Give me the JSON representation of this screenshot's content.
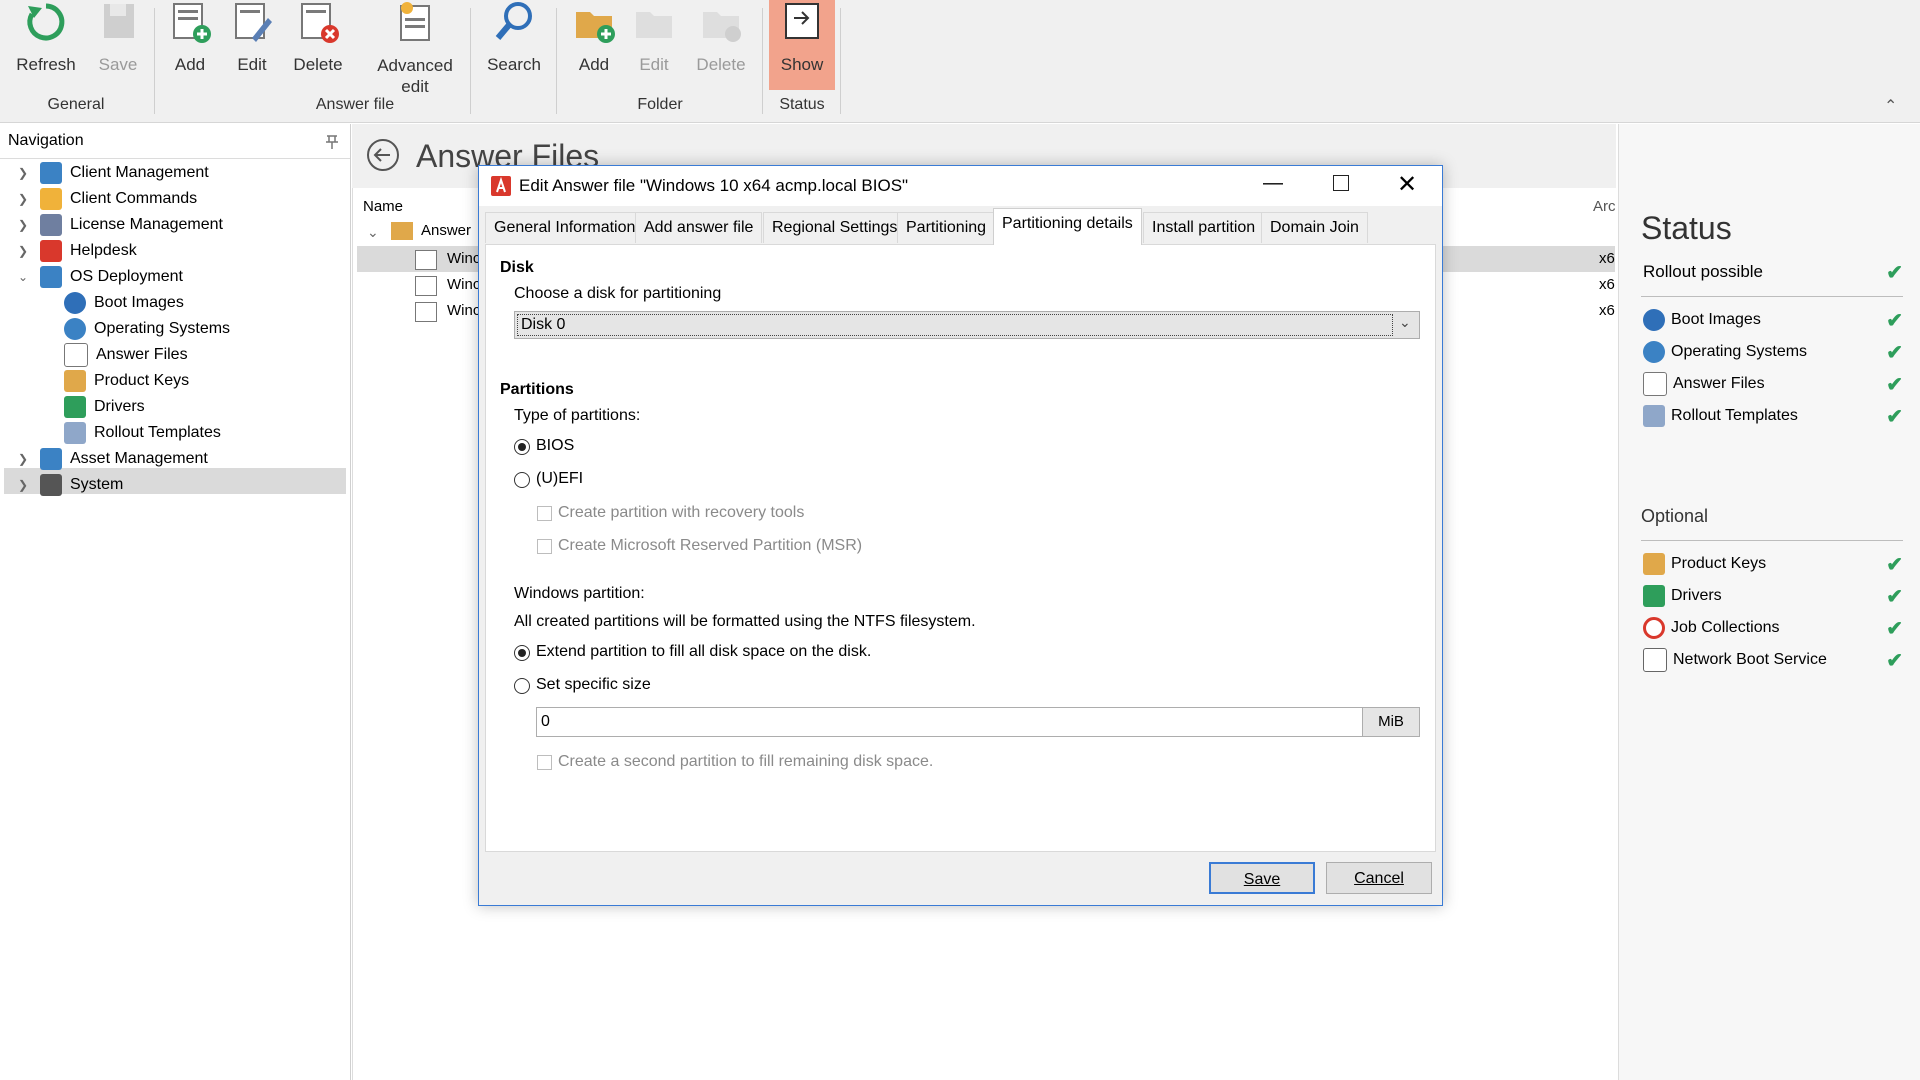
{
  "ribbon": {
    "buttons": [
      {
        "label": "Refresh",
        "enabled": true,
        "icon": "refresh-icon"
      },
      {
        "label": "Save",
        "enabled": false,
        "icon": "floppy-disk-icon"
      },
      {
        "label": "Add",
        "enabled": true,
        "icon": "add-document-icon"
      },
      {
        "label": "Edit",
        "enabled": true,
        "icon": "edit-document-icon"
      },
      {
        "label": "Delete",
        "enabled": true,
        "icon": "delete-document-icon"
      },
      {
        "label": "Advanced\nedit",
        "enabled": true,
        "icon": "advanced-edit-icon"
      },
      {
        "label": "Search",
        "enabled": true,
        "icon": "magnifier-icon"
      },
      {
        "label": "Add",
        "enabled": true,
        "icon": "add-folder-icon"
      },
      {
        "label": "Edit",
        "enabled": false,
        "icon": "edit-folder-icon"
      },
      {
        "label": "Delete",
        "enabled": false,
        "icon": "delete-folder-icon"
      },
      {
        "label": "Show",
        "enabled": true,
        "active": true,
        "icon": "show-status-icon"
      }
    ],
    "groups": [
      "General",
      "Answer file",
      "Folder",
      "Status"
    ],
    "collapse_glyph": "⌃"
  },
  "navigation": {
    "title": "Navigation",
    "items": [
      {
        "label": "Client Management",
        "expandable": true
      },
      {
        "label": "Client Commands",
        "expandable": true
      },
      {
        "label": "License Management",
        "expandable": true
      },
      {
        "label": "Helpdesk",
        "expandable": true
      },
      {
        "label": "OS Deployment",
        "expandable": true,
        "expanded": true
      },
      {
        "label": "Boot Images"
      },
      {
        "label": "Operating Systems"
      },
      {
        "label": "Answer Files",
        "selected": true
      },
      {
        "label": "Product Keys"
      },
      {
        "label": "Drivers"
      },
      {
        "label": "Rollout Templates"
      },
      {
        "label": "Asset Management",
        "expandable": true
      },
      {
        "label": "System",
        "expandable": true
      }
    ]
  },
  "content": {
    "title": "Answer Files",
    "columns": {
      "name": "Name",
      "arch": "Arc"
    },
    "folder": "Answer",
    "rows": [
      {
        "name": "Winc",
        "arch": "x6"
      },
      {
        "name": "Winc",
        "arch": "x6"
      },
      {
        "name": "Winc",
        "arch": "x6"
      }
    ]
  },
  "status": {
    "title": "Status",
    "rollout_label": "Rollout possible",
    "required": [
      "Boot Images",
      "Operating Systems",
      "Answer Files",
      "Rollout Templates"
    ],
    "optional_label": "Optional",
    "optional": [
      "Product Keys",
      "Drivers",
      "Job Collections",
      "Network Boot Service"
    ],
    "check_color": "#2e9e5b"
  },
  "dialog": {
    "title": "Edit Answer file \"Windows 10 x64 acmp.local BIOS\"",
    "tabs": [
      "General Information",
      "Add answer file",
      "Regional Settings",
      "Partitioning",
      "Partitioning details",
      "Install partition",
      "Domain Join"
    ],
    "active_tab": "Partitioning details",
    "disk_section": "Disk",
    "disk_prompt": "Choose a disk for partitioning",
    "disk_value": "Disk 0",
    "partitions_section": "Partitions",
    "type_label": "Type of partitions:",
    "type_bios": "BIOS",
    "type_uefi": "(U)EFI",
    "type_selected": "BIOS",
    "cb_recovery": "Create partition with recovery tools",
    "cb_msr": "Create Microsoft Reserved Partition (MSR)",
    "win_partition_label": "Windows partition:",
    "ntfs_note": "All created partitions will be formatted using the NTFS filesystem.",
    "opt_extend": "Extend partition to fill all disk space on the disk.",
    "opt_specific": "Set specific size",
    "size_value": "0",
    "size_unit": "MiB",
    "cb_second": "Create a second partition to fill remaining disk space.",
    "save": "Save",
    "cancel": "Cancel"
  }
}
